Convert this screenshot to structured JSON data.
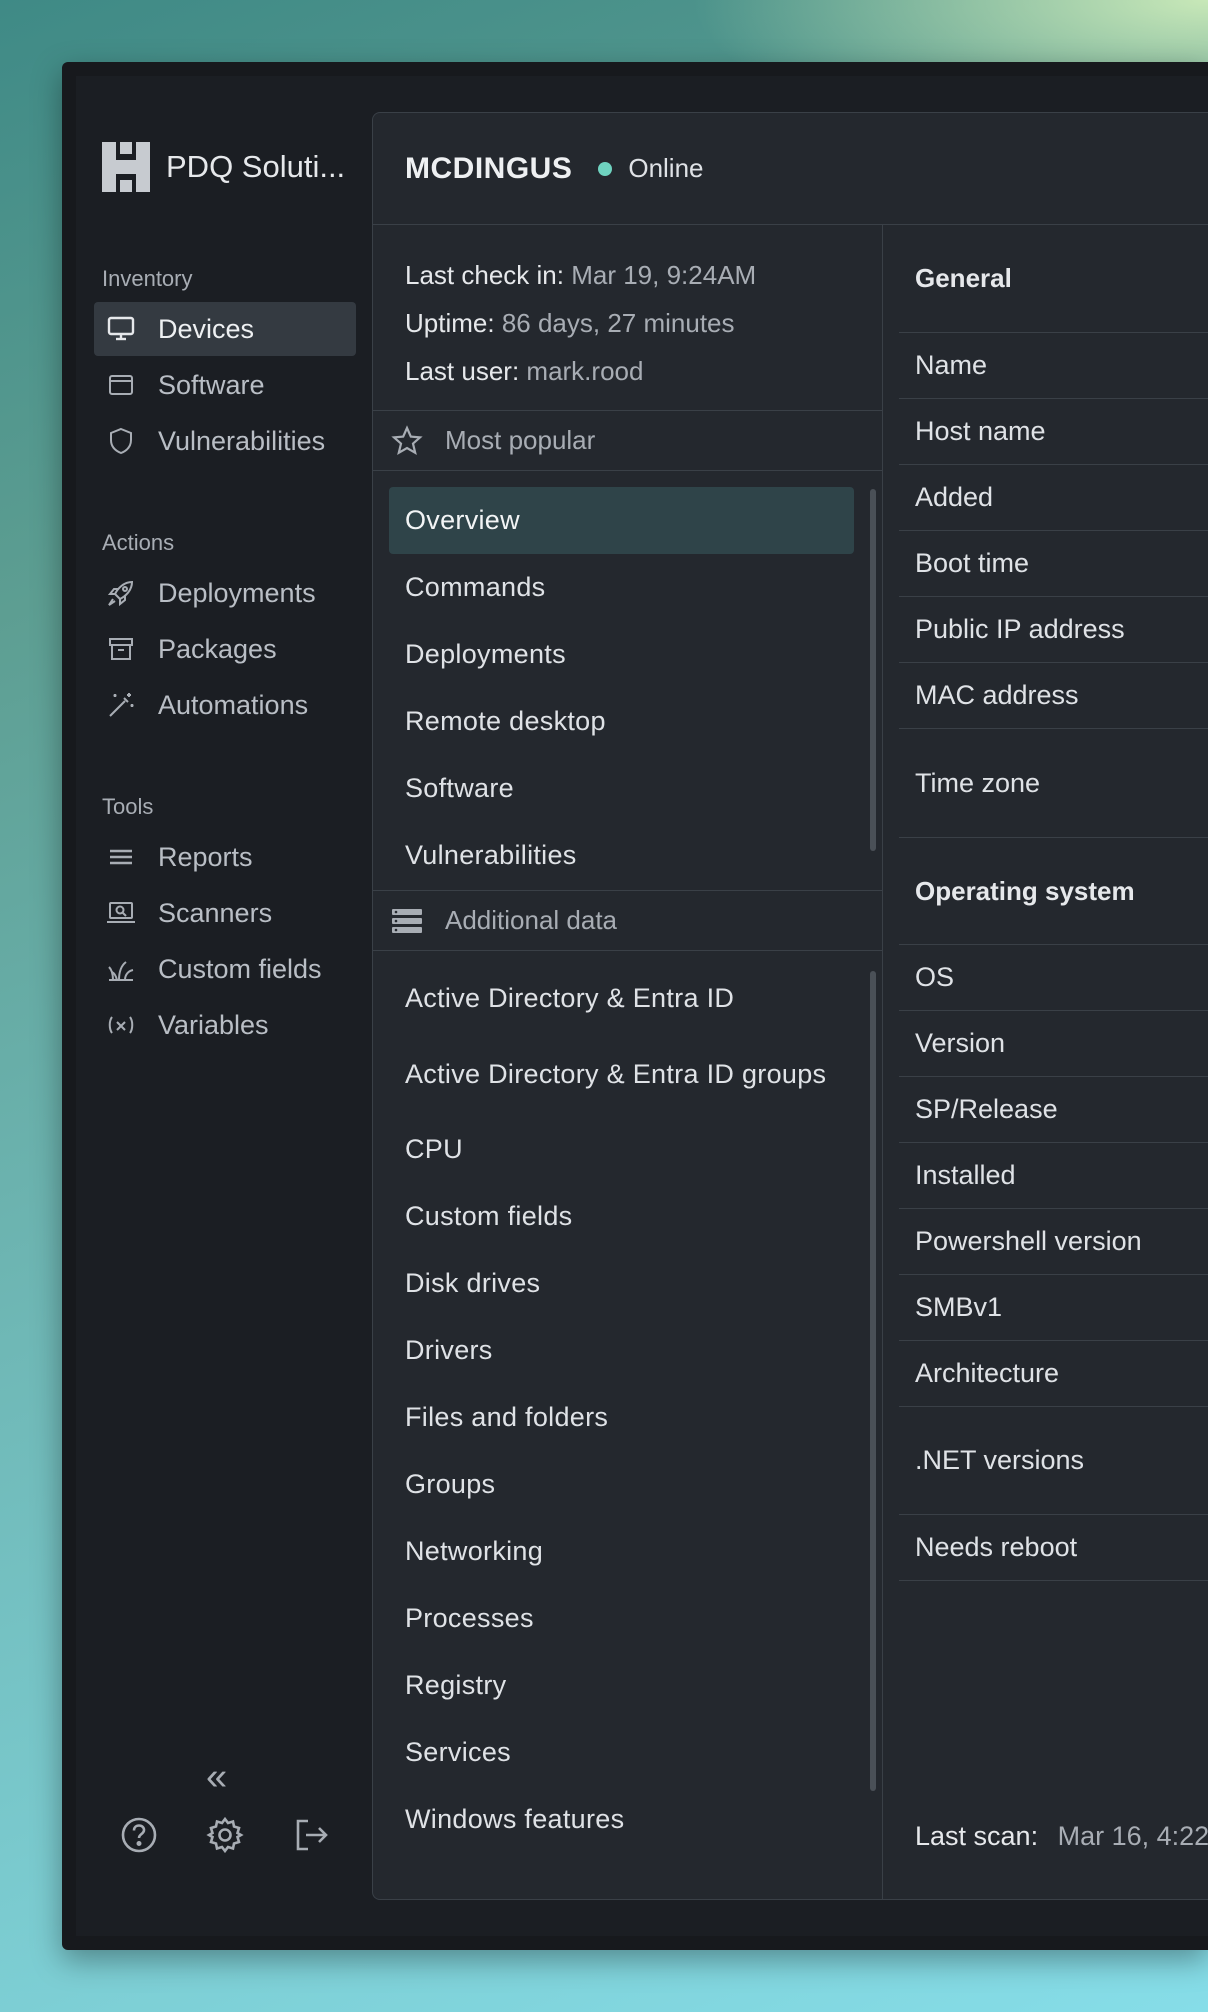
{
  "brand": {
    "name": "PDQ Soluti..."
  },
  "sidebar": {
    "sections": [
      {
        "heading": "Inventory",
        "items": [
          {
            "label": "Devices",
            "icon": "monitor-icon",
            "active": true
          },
          {
            "label": "Software",
            "icon": "window-icon"
          },
          {
            "label": "Vulnerabilities",
            "icon": "shield-icon"
          }
        ]
      },
      {
        "heading": "Actions",
        "items": [
          {
            "label": "Deployments",
            "icon": "rocket-icon"
          },
          {
            "label": "Packages",
            "icon": "archive-icon"
          },
          {
            "label": "Automations",
            "icon": "magic-wand-icon"
          }
        ]
      },
      {
        "heading": "Tools",
        "items": [
          {
            "label": "Reports",
            "icon": "list-icon"
          },
          {
            "label": "Scanners",
            "icon": "laptop-scan-icon"
          },
          {
            "label": "Custom fields",
            "icon": "grass-icon"
          },
          {
            "label": "Variables",
            "icon": "variable-icon"
          }
        ]
      }
    ],
    "collapse_label": "«",
    "footer_icons": [
      "help-icon",
      "gear-icon",
      "logout-icon"
    ]
  },
  "device": {
    "name": "MCDINGUS",
    "status": "Online",
    "status_color": "#6fd3c0",
    "last_check_in_label": "Last check in:",
    "last_check_in": "Mar 19, 9:24AM",
    "uptime_label": "Uptime:",
    "uptime": "86 days, 27 minutes",
    "last_user_label": "Last user:",
    "last_user": "mark.rood"
  },
  "most_popular": {
    "header": "Most popular",
    "items": [
      "Overview",
      "Commands",
      "Deployments",
      "Remote desktop",
      "Software",
      "Vulnerabilities"
    ],
    "selected": "Overview"
  },
  "additional_data": {
    "header": "Additional data",
    "items": [
      "Active Directory & Entra ID",
      "Active Directory & Entra ID groups",
      "CPU",
      "Custom fields",
      "Disk drives",
      "Drivers",
      "Files and folders",
      "Groups",
      "Networking",
      "Processes",
      "Registry",
      "Services",
      "Windows features"
    ]
  },
  "properties": {
    "general_title": "General",
    "general": [
      "Name",
      "Host name",
      "Added",
      "Boot time",
      "Public IP address",
      "MAC address",
      "Time zone"
    ],
    "os_title": "Operating system",
    "os": [
      "OS",
      "Version",
      "SP/Release",
      "Installed",
      "Powershell version",
      "SMBv1",
      "Architecture",
      ".NET versions",
      "Needs reboot"
    ],
    "last_scan_label": "Last scan:",
    "last_scan": "Mar 16, 4:22"
  }
}
